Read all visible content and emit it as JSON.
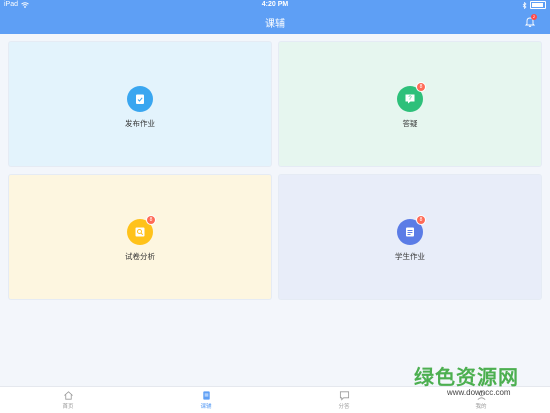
{
  "status_bar": {
    "device": "iPad",
    "time": "4:20 PM"
  },
  "header": {
    "title": "课辅",
    "notification_count": "2"
  },
  "cards": [
    {
      "label": "发布作业",
      "badge": "",
      "bg": "#e3f3fc",
      "icon_color": "#3aa6f0",
      "icon": "clipboard-check-icon"
    },
    {
      "label": "答疑",
      "badge": "8",
      "bg": "#e6f6ef",
      "icon_color": "#2ec07a",
      "icon": "question-chat-icon"
    },
    {
      "label": "试卷分析",
      "badge": "8",
      "bg": "#fdf6e0",
      "icon_color": "#ffc21a",
      "icon": "search-paper-icon"
    },
    {
      "label": "学生作业",
      "badge": "8",
      "bg": "#e8edf9",
      "icon_color": "#5b7ce6",
      "icon": "document-icon"
    }
  ],
  "tabs": [
    {
      "label": "首页",
      "icon": "home-icon",
      "active": false
    },
    {
      "label": "课辅",
      "icon": "book-icon",
      "active": true
    },
    {
      "label": "分答",
      "icon": "chat-icon",
      "active": false
    },
    {
      "label": "我的",
      "icon": "user-icon",
      "active": false
    }
  ],
  "watermark": {
    "text": "绿色资源网",
    "url": "www.downcc.com"
  },
  "colors": {
    "primary": "#5e9ff5",
    "badge": "#ff6b57"
  }
}
